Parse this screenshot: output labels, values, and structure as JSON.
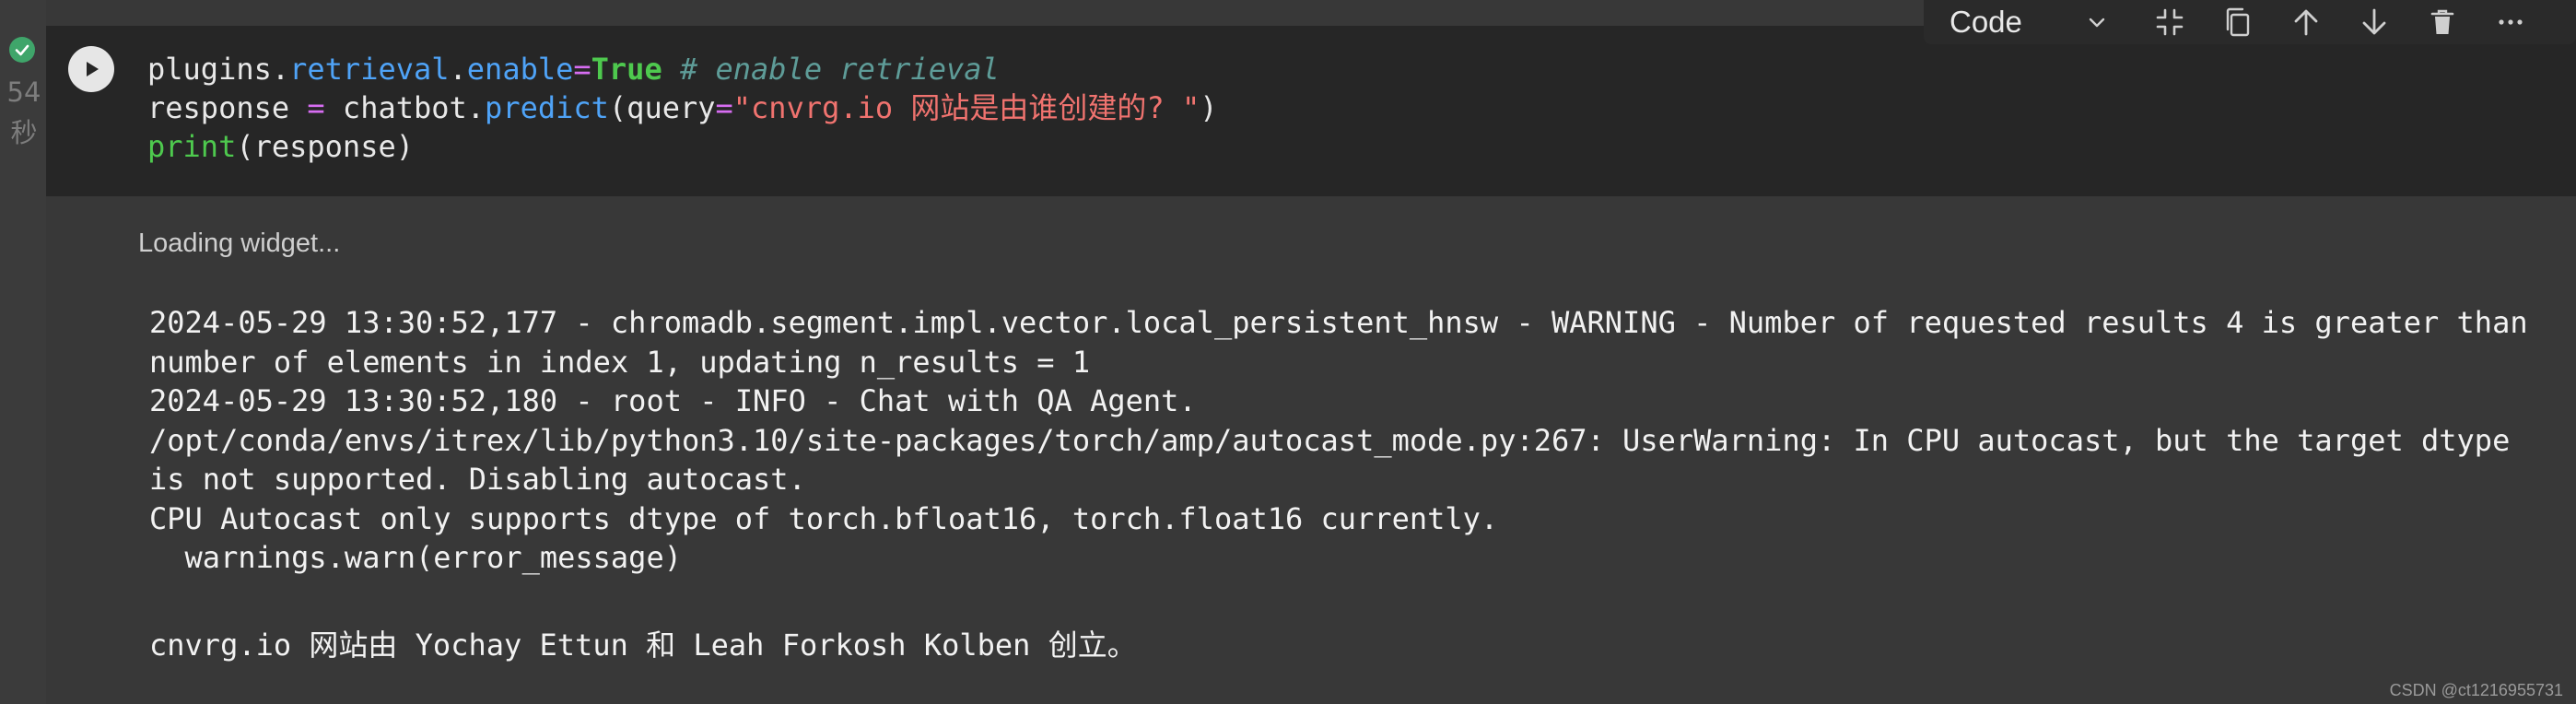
{
  "gutter": {
    "exec_time_number": "54",
    "exec_time_unit": "秒"
  },
  "toolbar": {
    "cell_type": "Code",
    "icons": [
      "chevron-down-icon",
      "collapse-icon",
      "copy-icon",
      "arrow-up-icon",
      "arrow-down-icon",
      "trash-icon",
      "more-icon"
    ]
  },
  "code": {
    "line1": {
      "obj": "plugins",
      "dot1": ".",
      "attr1": "retrieval",
      "dot2": ".",
      "attr2": "enable",
      "eq": "=",
      "val": "True",
      "comment": " # enable retrieval"
    },
    "line2": {
      "lhs": "response ",
      "eq": "=",
      "obj": " chatbot.",
      "fn": "predict",
      "open": "(query",
      "eq2": "=",
      "str": "\"cnvrg.io 网站是由谁创建的? \"",
      "close": ")"
    },
    "line3": {
      "fn": "print",
      "args": "(response)"
    }
  },
  "output": {
    "loading": "Loading widget...",
    "stderr": "2024-05-29 13:30:52,177 - chromadb.segment.impl.vector.local_persistent_hnsw - WARNING - Number of requested results 4 is greater than\nnumber of elements in index 1, updating n_results = 1\n2024-05-29 13:30:52,180 - root - INFO - Chat with QA Agent.\n/opt/conda/envs/itrex/lib/python3.10/site-packages/torch/amp/autocast_mode.py:267: UserWarning: In CPU autocast, but the target dtype\nis not supported. Disabling autocast.\nCPU Autocast only supports dtype of torch.bfloat16, torch.float16 currently.\n  warnings.warn(error_message)",
    "result": "cnvrg.io 网站由 Yochay Ettun 和 Leah Forkosh Kolben 创立。"
  },
  "watermark": "CSDN @ct1216955731",
  "colors": {
    "background": "#383838",
    "code_cell": "#262626",
    "status_ok": "#3fa56a",
    "keyword": "#4ec94e",
    "attribute": "#4fa3f7",
    "operator": "#d76df2",
    "string": "#f0736f",
    "comment": "#5e9c98"
  }
}
